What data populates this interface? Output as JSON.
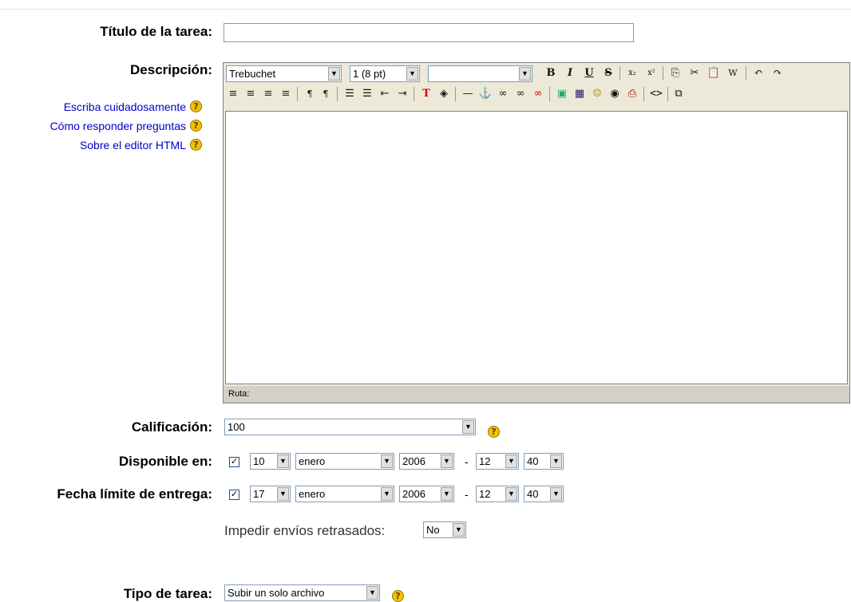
{
  "labels": {
    "titulo": "Título de la tarea:",
    "descripcion": "Descripción:",
    "calificacion": "Calificación:",
    "disponible": "Disponible en:",
    "fecha_limite": "Fecha límite de entrega:",
    "impedir": "Impedir envíos retrasados:",
    "tipo": "Tipo de tarea:"
  },
  "help_links": [
    "Escriba cuidadosamente",
    "Cómo responder preguntas",
    "Sobre el editor HTML"
  ],
  "titulo_input": {
    "value": ""
  },
  "editor": {
    "font_family": "Trebuchet",
    "font_size": "1 (8 pt)",
    "style": "",
    "path_label": "Ruta:"
  },
  "calificacion_value": "100",
  "disponible": {
    "checked": true,
    "day": "10",
    "month": "enero",
    "year": "2006",
    "hour": "12",
    "minute": "40"
  },
  "fecha_limite": {
    "checked": true,
    "day": "17",
    "month": "enero",
    "year": "2006",
    "hour": "12",
    "minute": "40"
  },
  "impedir_value": "No",
  "tipo_value": "Subir un solo archivo",
  "date_separator": "-",
  "colors": {
    "link": "#0000cc",
    "help_icon": "#f2c200",
    "toolbar_bg": "#ece9d8"
  }
}
